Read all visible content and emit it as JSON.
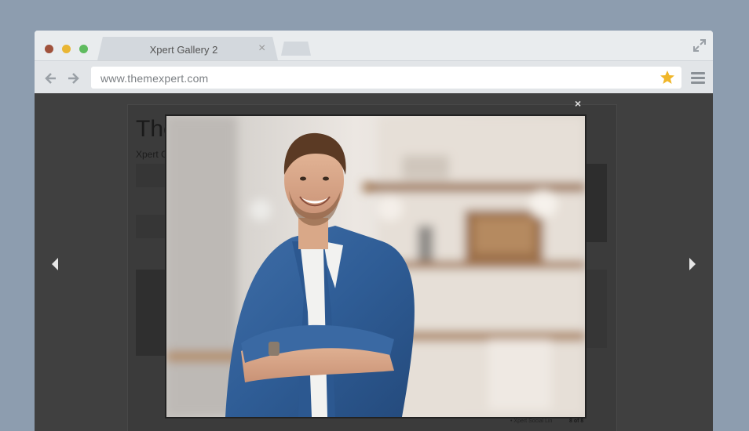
{
  "browser": {
    "tab_title": "Xpert Gallery 2",
    "tab_close": "×",
    "url": "www.themexpert.com",
    "colors": {
      "dot_red": "#a0523c",
      "dot_yellow": "#e9b634",
      "dot_green": "#5fbb5f",
      "star": "#f0b629",
      "desktop_bg": "#8d9daf"
    }
  },
  "page": {
    "heading": "The",
    "subheading": "Xpert G",
    "footer_item": "• Xpert Social Lin",
    "counter": "8 of 8"
  },
  "lightbox": {
    "close_label": "×",
    "image_description": "smiling man in denim shirt with arms crossed in front of a blurred shelf",
    "prev_icon": "chevron-left-icon",
    "next_icon": "chevron-right-icon"
  }
}
